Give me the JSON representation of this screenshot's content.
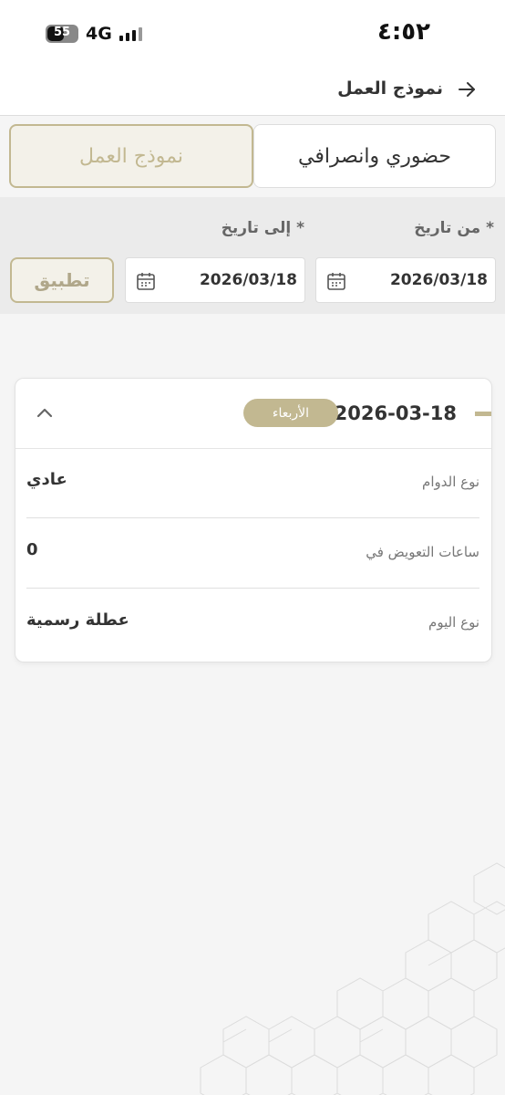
{
  "status_bar": {
    "time": "٤:٥٢",
    "network": "4G",
    "battery": "55",
    "battery_level": 0.55
  },
  "header": {
    "title": "نموذج العمل",
    "back_icon": "arrow-right-icon"
  },
  "tabs": [
    {
      "label": "حضوري وانصرافي",
      "active": false
    },
    {
      "label": "نموذج العمل",
      "active": true
    }
  ],
  "filter": {
    "from_label": "من تاريخ *",
    "to_label": "إلى تاريخ *",
    "from_value": "2026/03/18",
    "to_value": "2026/03/18",
    "apply_label": "تطبيق",
    "calendar_icon": "calendar-icon"
  },
  "record": {
    "date": "2026-03-18",
    "day": "الأربعاء",
    "collapse_icon": "chevron-up-icon",
    "rows": [
      {
        "label": "نوع الدوام",
        "value": "عادي"
      },
      {
        "label": "ساعات التعويض في",
        "value": "0"
      },
      {
        "label": "نوع اليوم",
        "value": "عطلة رسمية"
      }
    ]
  },
  "colors": {
    "accent": "#c2b891",
    "accent_bg": "#f3f1e9",
    "page_bg": "#f5f5f5",
    "filter_bg": "#ebebeb",
    "text": "#333333"
  }
}
